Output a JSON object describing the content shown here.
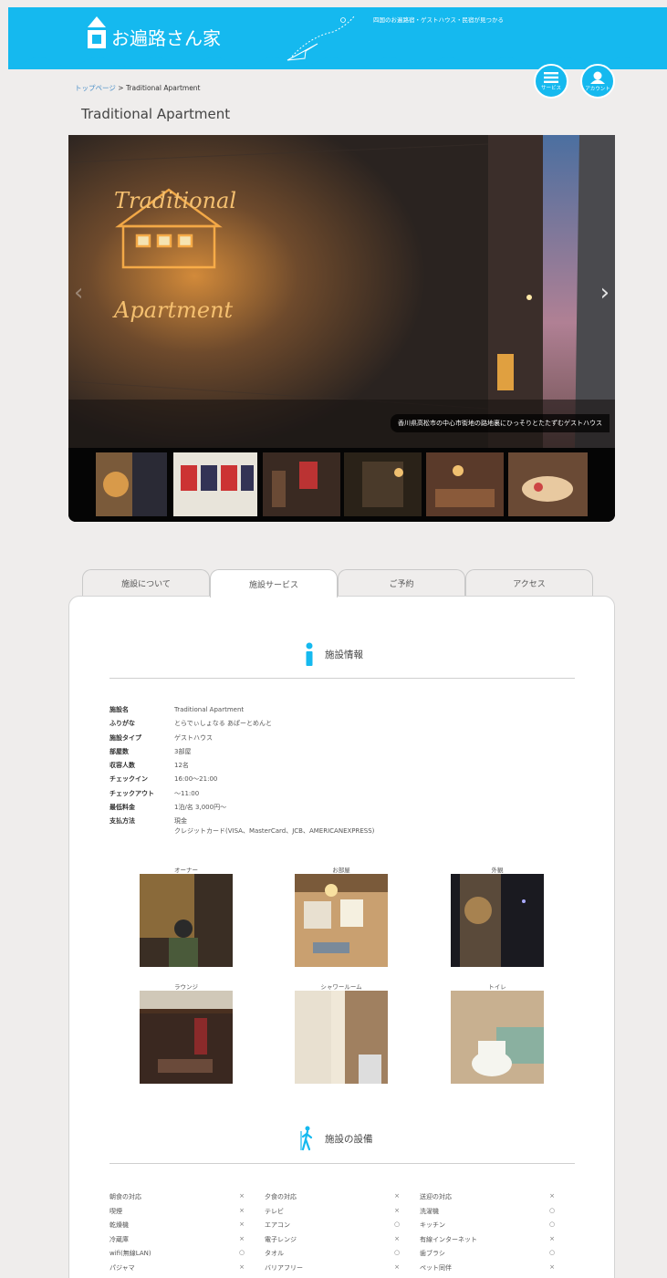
{
  "header": {
    "logo_text": "お遍路さん家",
    "tagline": "四国のお遍路宿・ゲストハウス・民宿が見つかる"
  },
  "nav": {
    "service_label": "サービス",
    "account_label": "アカウント"
  },
  "breadcrumb": {
    "home": "トップページ",
    "separator": ">",
    "current": "Traditional Apartment"
  },
  "page_title": "Traditional Apartment",
  "slider": {
    "caption": "香川県高松市の中心市街地の路地裏にひっそりとたたずむゲストハウス",
    "sign_text_1": "Traditional",
    "sign_text_2": "Apartment"
  },
  "tabs": [
    {
      "label": "施設について"
    },
    {
      "label": "施設サービス"
    },
    {
      "label": "ご予約"
    },
    {
      "label": "アクセス"
    }
  ],
  "facility_info": {
    "heading": "施設情報",
    "rows": [
      {
        "label": "施設名",
        "value": "Traditional Apartment"
      },
      {
        "label": "ふりがな",
        "value": "とらでぃしょなる あぱーとめんと"
      },
      {
        "label": "施設タイプ",
        "value": "ゲストハウス"
      },
      {
        "label": "部屋数",
        "value": "3部屋"
      },
      {
        "label": "収容人数",
        "value": "12名"
      },
      {
        "label": "チェックイン",
        "value": "16:00～21:00"
      },
      {
        "label": "チェックアウト",
        "value": "～11:00"
      },
      {
        "label": "最低料金",
        "value": "1泊/名 3,000円～"
      },
      {
        "label": "支払方法",
        "value": "現金\nクレジットカード(VISA、MasterCard、JCB、AMERICANEXPRESS)"
      }
    ]
  },
  "photos": [
    {
      "caption": "オーナー"
    },
    {
      "caption": "お部屋"
    },
    {
      "caption": "外観"
    },
    {
      "caption": "ラウンジ"
    },
    {
      "caption": "シャワールーム"
    },
    {
      "caption": "トイレ"
    }
  ],
  "equipment": {
    "heading": "施設の設備",
    "rows": [
      [
        {
          "name": "朝食の対応",
          "value": "×"
        },
        {
          "name": "夕食の対応",
          "value": "×"
        },
        {
          "name": "送迎の対応",
          "value": "×"
        }
      ],
      [
        {
          "name": "喫煙",
          "value": "×"
        },
        {
          "name": "テレビ",
          "value": "×"
        },
        {
          "name": "洗濯機",
          "value": "○"
        }
      ],
      [
        {
          "name": "乾燥機",
          "value": "×"
        },
        {
          "name": "エアコン",
          "value": "○"
        },
        {
          "name": "キッチン",
          "value": "○"
        }
      ],
      [
        {
          "name": "冷蔵庫",
          "value": "×"
        },
        {
          "name": "電子レンジ",
          "value": "×"
        },
        {
          "name": "有線インターネット",
          "value": "×"
        }
      ],
      [
        {
          "name": "wifi(無線LAN)",
          "value": "○"
        },
        {
          "name": "タオル",
          "value": "○"
        },
        {
          "name": "歯ブラシ",
          "value": "○"
        }
      ],
      [
        {
          "name": "パジャマ",
          "value": "×"
        },
        {
          "name": "バリアフリー",
          "value": "×"
        },
        {
          "name": "ペット同伴",
          "value": "×"
        }
      ]
    ]
  },
  "colors": {
    "brand": "#15b9ef",
    "background": "#efedec"
  }
}
